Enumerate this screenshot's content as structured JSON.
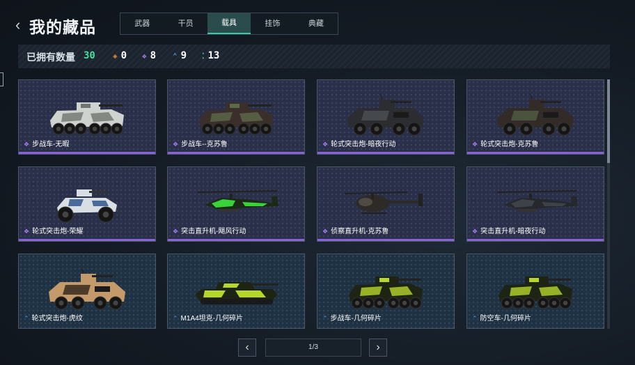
{
  "header": {
    "back_glyph": "‹",
    "title": "我的藏品"
  },
  "tabs": [
    {
      "label": "武器",
      "active": false
    },
    {
      "label": "干员",
      "active": false
    },
    {
      "label": "载具",
      "active": true
    },
    {
      "label": "挂饰",
      "active": false
    },
    {
      "label": "典藏",
      "active": false
    }
  ],
  "stats": {
    "owned_label": "已拥有数量",
    "owned_count": "30",
    "items": [
      {
        "icon": "orange-diamond-icon",
        "glyph": "◈",
        "color": "#e0873a",
        "value": "0"
      },
      {
        "icon": "purple-diamond-icon",
        "glyph": "❖",
        "color": "#a77cf0",
        "value": "8"
      },
      {
        "icon": "blue-chevron-icon",
        "glyph": "⌃",
        "color": "#4aa3ea",
        "value": "9"
      },
      {
        "icon": "green-dots-icon",
        "glyph": "⁚",
        "color": "#3fe0a0",
        "value": "13"
      }
    ]
  },
  "colors": {
    "accent_green": "#3fe0a0",
    "rarity_purple": "#a77cf0",
    "rarity_blue": "#4aa3ea"
  },
  "cards": [
    {
      "label": "步战车-无暇",
      "rarity": "purple",
      "vehicle": "ifv-icon",
      "body": "#cfd3cf",
      "camo": "#6f756f"
    },
    {
      "label": "步战车--克苏鲁",
      "rarity": "purple",
      "vehicle": "ifv-icon",
      "body": "#3b2f2c",
      "camo": "#5c6a4a"
    },
    {
      "label": "轮式突击炮-暗夜行动",
      "rarity": "purple",
      "vehicle": "armored-car-icon",
      "body": "#2b2d30",
      "camo": "#4a4d52"
    },
    {
      "label": "轮式突击炮-克苏鲁",
      "rarity": "purple",
      "vehicle": "armored-car-icon",
      "body": "#332b28",
      "camo": "#4f5a40"
    },
    {
      "label": "轮式突击炮-荣耀",
      "rarity": "purple",
      "vehicle": "buggy-icon",
      "body": "#d8dee4",
      "camo": "#4a6b9a"
    },
    {
      "label": "突击直升机-飓风行动",
      "rarity": "purple",
      "vehicle": "attack-helicopter-icon",
      "body": "#1b2a16",
      "camo": "#39d23a"
    },
    {
      "label": "侦察直升机-克苏鲁",
      "rarity": "purple",
      "vehicle": "scout-helicopter-icon",
      "body": "#2e2a27",
      "camo": "#4f4a44"
    },
    {
      "label": "突击直升机-暗夜行动",
      "rarity": "purple",
      "vehicle": "attack-helicopter-icon",
      "body": "#25282c",
      "camo": "#3d4148"
    },
    {
      "label": "轮式突击炮-虎纹",
      "rarity": "blue",
      "vehicle": "armored-car-icon",
      "body": "#c49a6a",
      "camo": "#3a2c20"
    },
    {
      "label": "M1A4坦克-几何碎片",
      "rarity": "blue",
      "vehicle": "tank-icon",
      "body": "#1d2414",
      "camo": "#b6d62c"
    },
    {
      "label": "步战车-几何碎片",
      "rarity": "blue",
      "vehicle": "ifv-icon",
      "body": "#1d2414",
      "camo": "#b6d62c"
    },
    {
      "label": "防空车-几何碎片",
      "rarity": "blue",
      "vehicle": "ifv-icon",
      "body": "#1d2414",
      "camo": "#b6d62c"
    }
  ],
  "pager": {
    "prev_glyph": "‹",
    "next_glyph": "›",
    "page": "1/3"
  }
}
